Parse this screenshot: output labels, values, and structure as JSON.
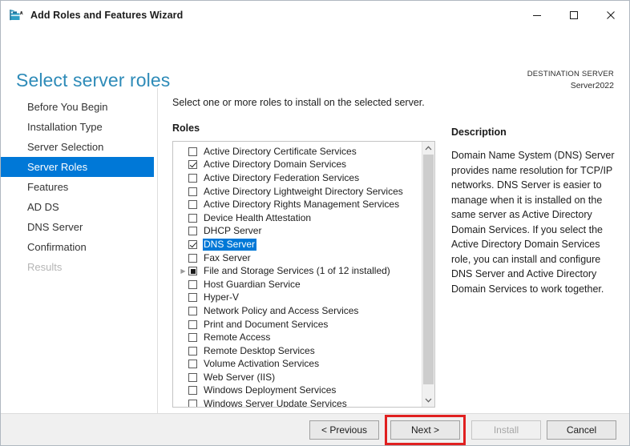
{
  "window": {
    "title": "Add Roles and Features Wizard",
    "icon": "wizard-toolbox-icon",
    "controls": {
      "minimize": "minimize-icon",
      "maximize": "maximize-icon",
      "close": "close-icon"
    }
  },
  "header": {
    "page_title": "Select server roles",
    "destination_label": "DESTINATION SERVER",
    "destination_value": "Server2022",
    "title_color": "#2e8bb8"
  },
  "sidebar": {
    "items": [
      {
        "label": "Before You Begin",
        "state": "normal"
      },
      {
        "label": "Installation Type",
        "state": "normal"
      },
      {
        "label": "Server Selection",
        "state": "normal"
      },
      {
        "label": "Server Roles",
        "state": "selected"
      },
      {
        "label": "Features",
        "state": "normal"
      },
      {
        "label": "AD DS",
        "state": "normal"
      },
      {
        "label": "DNS Server",
        "state": "normal"
      },
      {
        "label": "Confirmation",
        "state": "normal"
      },
      {
        "label": "Results",
        "state": "disabled"
      }
    ],
    "selected_color": "#0078d7"
  },
  "main": {
    "instruction": "Select one or more roles to install on the selected server.",
    "roles_label": "Roles",
    "scrollbar": {
      "up_arrow": "chevron-up-icon",
      "down_arrow": "chevron-down-icon"
    },
    "roles": [
      {
        "label": "Active Directory Certificate Services",
        "checked": "unchecked",
        "expandable": false,
        "selected": false
      },
      {
        "label": "Active Directory Domain Services",
        "checked": "checked",
        "expandable": false,
        "selected": false
      },
      {
        "label": "Active Directory Federation Services",
        "checked": "unchecked",
        "expandable": false,
        "selected": false
      },
      {
        "label": "Active Directory Lightweight Directory Services",
        "checked": "unchecked",
        "expandable": false,
        "selected": false
      },
      {
        "label": "Active Directory Rights Management Services",
        "checked": "unchecked",
        "expandable": false,
        "selected": false
      },
      {
        "label": "Device Health Attestation",
        "checked": "unchecked",
        "expandable": false,
        "selected": false
      },
      {
        "label": "DHCP Server",
        "checked": "unchecked",
        "expandable": false,
        "selected": false
      },
      {
        "label": "DNS Server",
        "checked": "checked",
        "expandable": false,
        "selected": true
      },
      {
        "label": "Fax Server",
        "checked": "unchecked",
        "expandable": false,
        "selected": false
      },
      {
        "label": "File and Storage Services (1 of 12 installed)",
        "checked": "partial",
        "expandable": true,
        "selected": false
      },
      {
        "label": "Host Guardian Service",
        "checked": "unchecked",
        "expandable": false,
        "selected": false
      },
      {
        "label": "Hyper-V",
        "checked": "unchecked",
        "expandable": false,
        "selected": false
      },
      {
        "label": "Network Policy and Access Services",
        "checked": "unchecked",
        "expandable": false,
        "selected": false
      },
      {
        "label": "Print and Document Services",
        "checked": "unchecked",
        "expandable": false,
        "selected": false
      },
      {
        "label": "Remote Access",
        "checked": "unchecked",
        "expandable": false,
        "selected": false
      },
      {
        "label": "Remote Desktop Services",
        "checked": "unchecked",
        "expandable": false,
        "selected": false
      },
      {
        "label": "Volume Activation Services",
        "checked": "unchecked",
        "expandable": false,
        "selected": false
      },
      {
        "label": "Web Server (IIS)",
        "checked": "unchecked",
        "expandable": false,
        "selected": false
      },
      {
        "label": "Windows Deployment Services",
        "checked": "unchecked",
        "expandable": false,
        "selected": false
      },
      {
        "label": "Windows Server Update Services",
        "checked": "unchecked",
        "expandable": false,
        "selected": false
      }
    ]
  },
  "description": {
    "title": "Description",
    "text": "Domain Name System (DNS) Server provides name resolution for TCP/IP networks. DNS Server is easier to manage when it is installed on the same server as Active Directory Domain Services. If you select the Active Directory Domain Services role, you can install and configure DNS Server and Active Directory Domain Services to work together."
  },
  "footer": {
    "previous": "< Previous",
    "next": "Next >",
    "install": "Install",
    "cancel": "Cancel",
    "install_disabled": true,
    "highlight_color": "#e02020",
    "highlighted_button": "Next >"
  }
}
